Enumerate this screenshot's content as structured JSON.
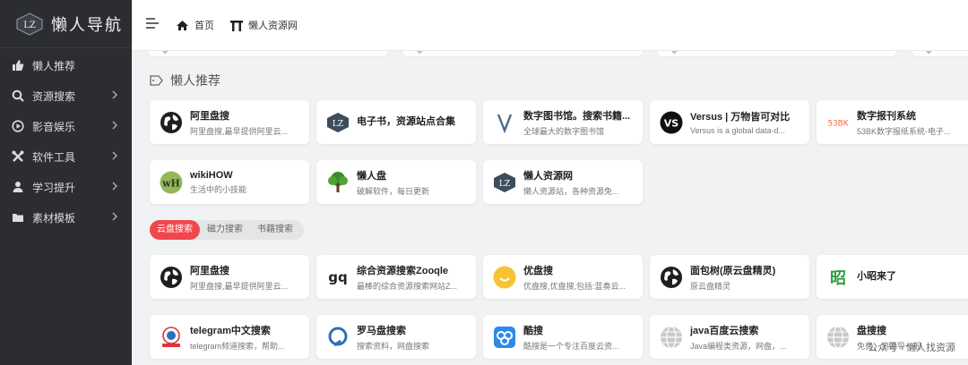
{
  "sidebar": {
    "logo_text": "懒人导航",
    "logo_badge": "LZ",
    "items": [
      {
        "label": "懒人推荐",
        "icon": "thumbs-up-icon",
        "arrow": false
      },
      {
        "label": "资源搜索",
        "icon": "search-icon",
        "arrow": true
      },
      {
        "label": "影音娱乐",
        "icon": "play-circle-icon",
        "arrow": true
      },
      {
        "label": "软件工具",
        "icon": "tools-icon",
        "arrow": true
      },
      {
        "label": "学习提升",
        "icon": "graduation-icon",
        "arrow": true
      },
      {
        "label": "素材模板",
        "icon": "folder-icon",
        "arrow": true
      }
    ]
  },
  "topbar": {
    "home_label": "首页",
    "site_label": "懒人资源网"
  },
  "section": {
    "title": "懒人推荐"
  },
  "recommend_cards": [
    {
      "title": "阿里盘搜",
      "desc": "阿里盘搜,最早提供阿里云...",
      "icon": "globe-icon"
    },
    {
      "title": "电子书，资源站点合集",
      "desc": "",
      "icon": "lz-logo-icon"
    },
    {
      "title": "数字图书馆。搜索书籍...",
      "desc": "全球最大的数字图书馆",
      "icon": "v-letter-icon"
    },
    {
      "title": "Versus | 万物皆可对比",
      "desc": "Versus is a global data-d...",
      "icon": "vs-icon",
      "icon_text": "VS"
    },
    {
      "title": "数字报刊系统",
      "desc": "53BK数字报纸系统-电子...",
      "icon": "53bk-icon",
      "icon_text": "53BK"
    },
    {
      "title": "wikiHOW",
      "desc": "生活中的小技能",
      "icon": "wikihow-icon",
      "icon_text": "wH"
    },
    {
      "title": "懒人盘",
      "desc": "破解软件，每日更新",
      "icon": "tree-icon"
    },
    {
      "title": "懒人资源网",
      "desc": "懒人资源站，各种资源免...",
      "icon": "lz-logo-icon"
    }
  ],
  "tabs": [
    "云盘搜索",
    "磁力搜索",
    "书籍搜索"
  ],
  "search_cards": [
    {
      "title": "阿里盘搜",
      "desc": "阿里盘搜,最早提供阿里云...",
      "icon": "globe-icon"
    },
    {
      "title": "综合资源搜索Zooqle",
      "desc": "最棒的综合资源搜索网站Z...",
      "icon": "zooqle-icon",
      "icon_text": "gq"
    },
    {
      "title": "优盘搜",
      "desc": "优盘搜,优盘搜,包括:蓝奏云...",
      "icon": "smile-icon"
    },
    {
      "title": "面包树(原云盘精灵)",
      "desc": "原云盘精灵",
      "icon": "globe-icon"
    },
    {
      "title": "小昭来了",
      "desc": "",
      "icon": "zhao-icon",
      "icon_text": "昭"
    },
    {
      "title": "telegram中文搜索",
      "desc": "telegram频道搜索，帮助...",
      "icon": "telegram-search-icon"
    },
    {
      "title": "罗马盘搜索",
      "desc": "搜索资料，网盘搜索",
      "icon": "roma-icon"
    },
    {
      "title": "酷搜",
      "desc": "酷搜是一个专注百度云资...",
      "icon": "kusou-icon"
    },
    {
      "title": "java百度云搜索",
      "desc": "Java编程类资源，网盘，...",
      "icon": "gray-globe-icon"
    },
    {
      "title": "盘搜搜",
      "desc": "免费，资源导一般",
      "icon": "gray-globe-icon"
    }
  ],
  "watermark": "公众号 · 懒人找资源",
  "colors": {
    "accent": "#f0474f",
    "sidebar_bg": "#2b2d31",
    "page_bg": "#f1f2f3"
  }
}
